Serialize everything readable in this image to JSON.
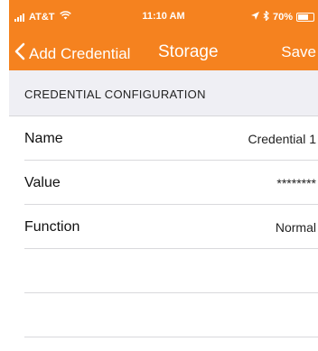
{
  "status_bar": {
    "carrier": "AT&T",
    "time": "11:10 AM",
    "battery": "70%",
    "battery_level": 0.7,
    "signal_icon": "signal-bars-icon",
    "wifi_icon": "wifi-icon",
    "location_icon": "location-arrow-icon",
    "bluetooth_icon": "bluetooth-icon"
  },
  "nav": {
    "back_label": "Add Credential",
    "title": "Storage",
    "save_label": "Save",
    "back_icon": "chevron-left-icon"
  },
  "section": {
    "header": "CREDENTIAL CONFIGURATION"
  },
  "rows": [
    {
      "label": "Name",
      "value": "Credential 1"
    },
    {
      "label": "Value",
      "value": "********"
    },
    {
      "label": "Function",
      "value": "Normal"
    },
    {
      "label": "",
      "value": ""
    },
    {
      "label": "",
      "value": ""
    }
  ],
  "colors": {
    "accent": "#f5821f",
    "section_bg": "#efeff4",
    "separator": "#d9d9dc"
  }
}
